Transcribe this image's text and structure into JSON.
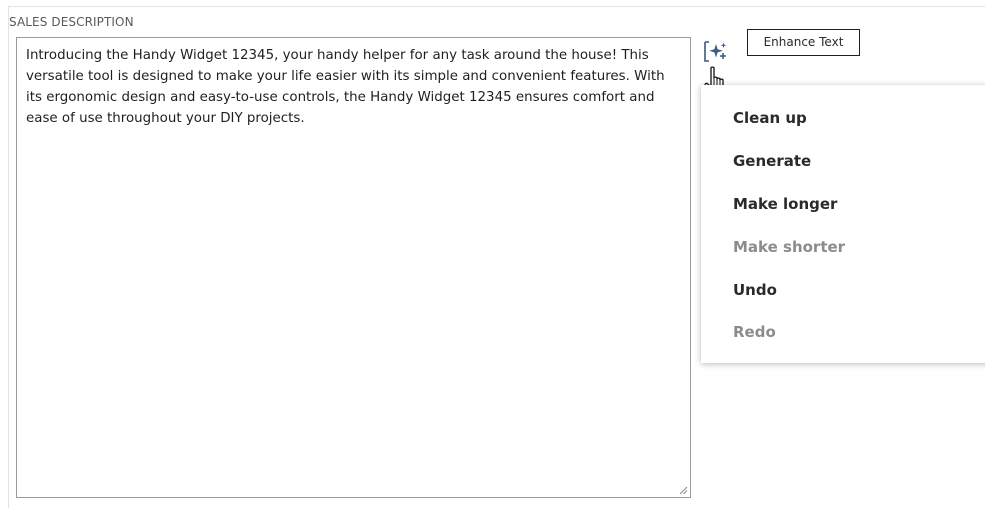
{
  "field": {
    "label": "SALES DESCRIPTION",
    "value": "Introducing the Handy Widget 12345, your handy helper for any task around the house! This versatile tool is designed to make your life easier with its simple and convenient features. With its ergonomic design and easy-to-use controls, the Handy Widget 12345 ensures comfort and ease of use throughout your DIY projects."
  },
  "tooltip": {
    "text": "Enhance Text"
  },
  "icons": {
    "enhance": "sparkle-edit-icon",
    "cursor": "hand-pointer-icon"
  },
  "menu": {
    "items": [
      {
        "label": "Clean up",
        "enabled": true
      },
      {
        "label": "Generate",
        "enabled": true
      },
      {
        "label": "Make longer",
        "enabled": true
      },
      {
        "label": "Make shorter",
        "enabled": false
      },
      {
        "label": "Undo",
        "enabled": true
      },
      {
        "label": "Redo",
        "enabled": false
      }
    ]
  },
  "colors": {
    "icon_accent": "#3d5a80",
    "text": "#1f1f1f",
    "disabled": "#8c8c8c"
  }
}
